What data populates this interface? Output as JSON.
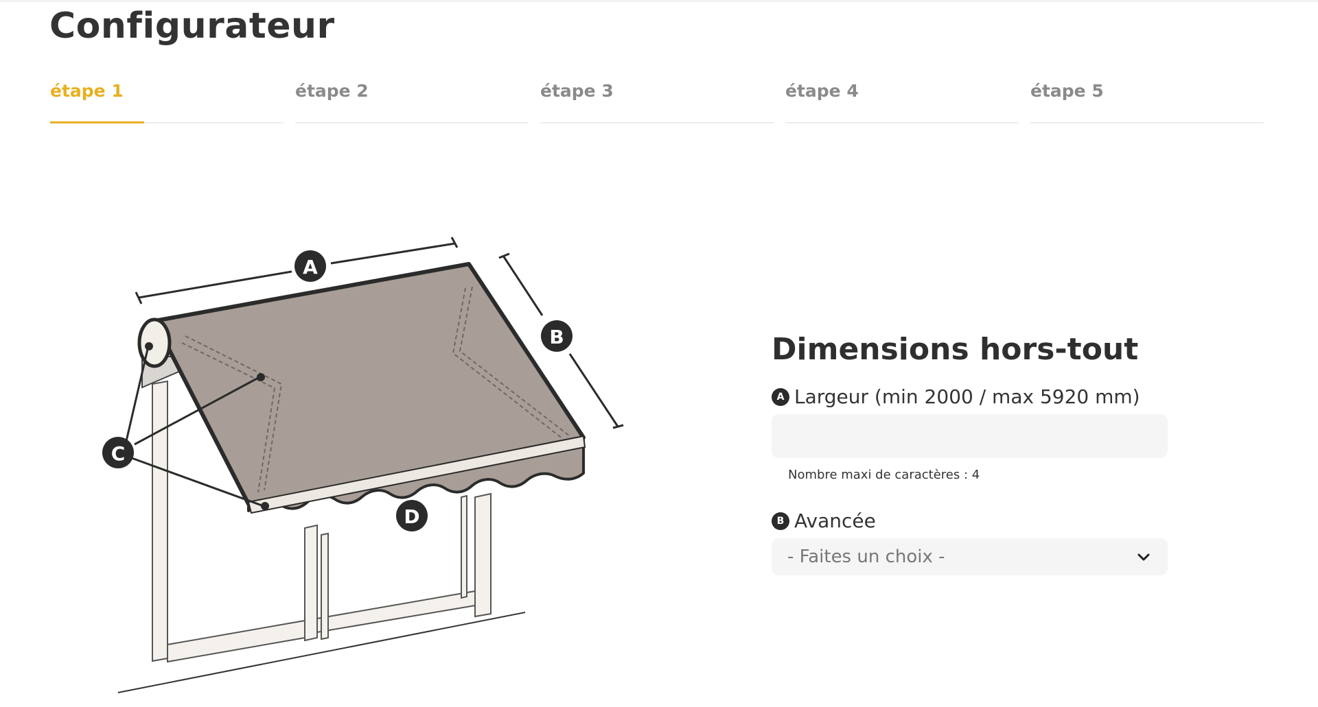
{
  "page": {
    "title": "Configurateur"
  },
  "steps": [
    {
      "label": "étape 1",
      "active": true
    },
    {
      "label": "étape 2",
      "active": false
    },
    {
      "label": "étape 3",
      "active": false
    },
    {
      "label": "étape 4",
      "active": false
    },
    {
      "label": "étape 5",
      "active": false
    }
  ],
  "diagram": {
    "markers": {
      "a": "A",
      "b": "B",
      "c": "C",
      "d": "D"
    }
  },
  "form": {
    "title": "Dimensions hors-tout",
    "largeur": {
      "badge": "A",
      "label": "Largeur (min 2000 / max 5920 mm)",
      "value": "",
      "hint": "Nombre maxi de caractères : 4"
    },
    "avancee": {
      "badge": "B",
      "label": "Avancée",
      "selected": "- Faites un choix -"
    }
  },
  "colors": {
    "accent": "#e8b021",
    "awning_fabric": "#a89e97",
    "outline": "#2b2b2b",
    "input_bg": "#f5f5f5"
  },
  "icons": {
    "select_arrow": "chevron-down-icon"
  }
}
